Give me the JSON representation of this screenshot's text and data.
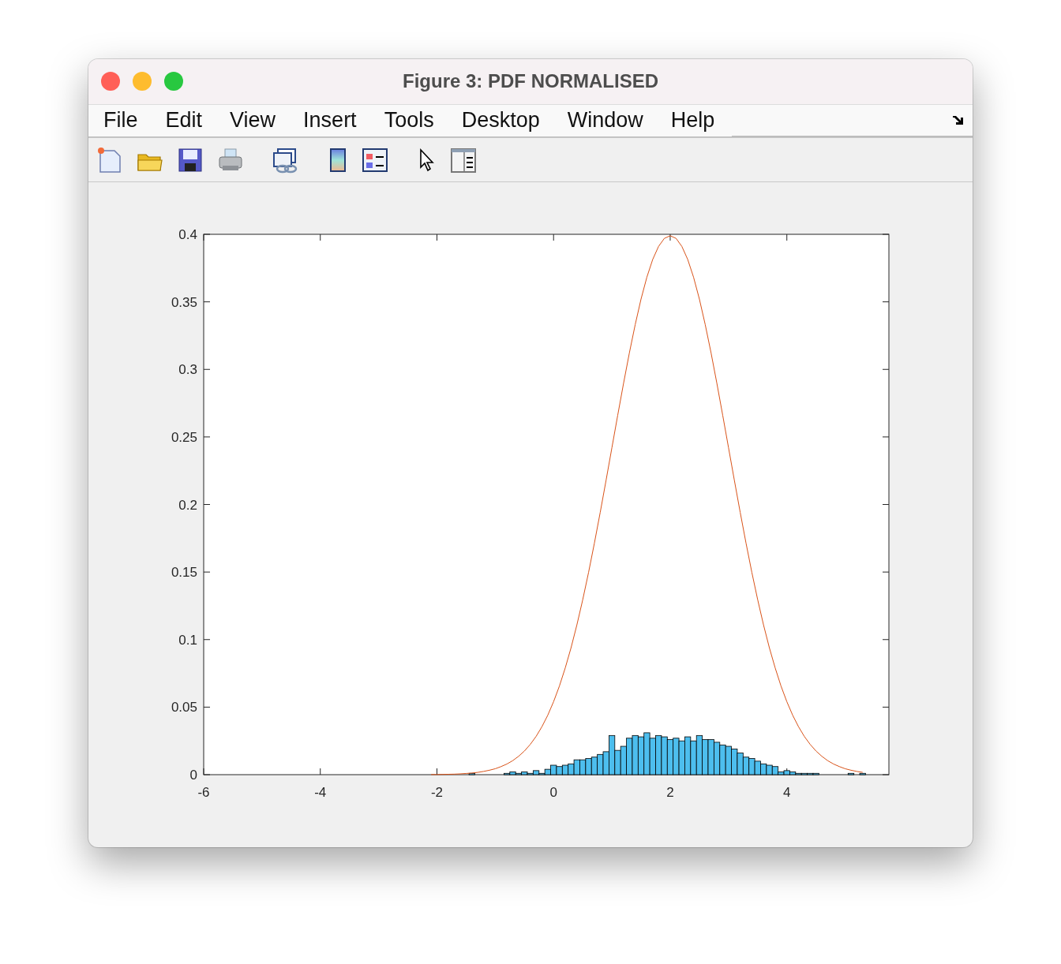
{
  "window": {
    "title": "Figure 3: PDF NORMALISED"
  },
  "menu": [
    "File",
    "Edit",
    "View",
    "Insert",
    "Tools",
    "Desktop",
    "Window",
    "Help"
  ],
  "chart_data": {
    "type": "bar",
    "x": [
      -2.1,
      -2,
      -1.9,
      -1.8,
      -1.7,
      -1.6,
      -1.5,
      -1.4,
      -1.3,
      -1.2,
      -1.1,
      -1,
      -0.9,
      -0.8,
      -0.7,
      -0.6,
      -0.5,
      -0.4,
      -0.3,
      -0.2,
      -0.1,
      0,
      0.1,
      0.2,
      0.3,
      0.4,
      0.5,
      0.6,
      0.7,
      0.8,
      0.9,
      1,
      1.1,
      1.2,
      1.3,
      1.4,
      1.5,
      1.6,
      1.7,
      1.8,
      1.9,
      2,
      2.1,
      2.2,
      2.3,
      2.4,
      2.5,
      2.6,
      2.7,
      2.8,
      2.9,
      3,
      3.1,
      3.2,
      3.3,
      3.4,
      3.5,
      3.6,
      3.7,
      3.8,
      3.9,
      4,
      4.1,
      4.2,
      4.3,
      4.4,
      4.5,
      4.6,
      4.7,
      4.8,
      4.9,
      5,
      5.1,
      5.2,
      5.3
    ],
    "series": [
      {
        "type": "bar",
        "color": "#4dbeee",
        "values": [
          null,
          null,
          null,
          null,
          null,
          null,
          null,
          0.001,
          null,
          null,
          null,
          null,
          null,
          0.001,
          0.002,
          0.001,
          0.002,
          0.001,
          0.003,
          0.001,
          0.004,
          0.007,
          0.006,
          0.007,
          0.008,
          0.011,
          0.011,
          0.012,
          0.013,
          0.015,
          0.017,
          0.029,
          0.018,
          0.021,
          0.027,
          0.029,
          0.028,
          0.031,
          0.027,
          0.029,
          0.028,
          0.026,
          0.027,
          0.025,
          0.028,
          0.025,
          0.029,
          0.026,
          0.026,
          0.024,
          0.022,
          0.021,
          0.019,
          0.016,
          0.013,
          0.012,
          0.01,
          0.008,
          0.007,
          0.006,
          0.002,
          0.003,
          0.002,
          0.001,
          0.001,
          0.001,
          0.001,
          null,
          null,
          null,
          null,
          null,
          0.001,
          null,
          0.001
        ]
      },
      {
        "type": "line",
        "color": "#d95319",
        "values": [
          0.0001,
          0.0001,
          0.0002,
          0.0003,
          0.0004,
          0.0006,
          0.0009,
          0.0012,
          0.0017,
          0.0024,
          0.0033,
          0.0044,
          0.006,
          0.0079,
          0.0104,
          0.0136,
          0.0175,
          0.0224,
          0.0283,
          0.0355,
          0.044,
          0.054,
          0.0656,
          0.079,
          0.094,
          0.1109,
          0.1295,
          0.1497,
          0.1714,
          0.1942,
          0.2179,
          0.242,
          0.2661,
          0.2897,
          0.3123,
          0.3332,
          0.3521,
          0.3683,
          0.3814,
          0.391,
          0.397,
          0.3989,
          0.397,
          0.391,
          0.3814,
          0.3683,
          0.3521,
          0.3332,
          0.3123,
          0.2897,
          0.2661,
          0.242,
          0.2179,
          0.1942,
          0.1714,
          0.1497,
          0.1295,
          0.1109,
          0.094,
          0.079,
          0.0656,
          0.054,
          0.044,
          0.0355,
          0.0283,
          0.0224,
          0.0175,
          0.0136,
          0.0104,
          0.0079,
          0.006,
          0.0044,
          0.0033,
          0.0024,
          0.0017
        ]
      }
    ],
    "xlim": [
      -6,
      5.75
    ],
    "ylim": [
      0,
      0.4
    ],
    "xticks": [
      -6,
      -4,
      -2,
      0,
      2,
      4
    ],
    "yticks": [
      0,
      0.05,
      0.1,
      0.15,
      0.2,
      0.25,
      0.3,
      0.35,
      0.4
    ]
  }
}
